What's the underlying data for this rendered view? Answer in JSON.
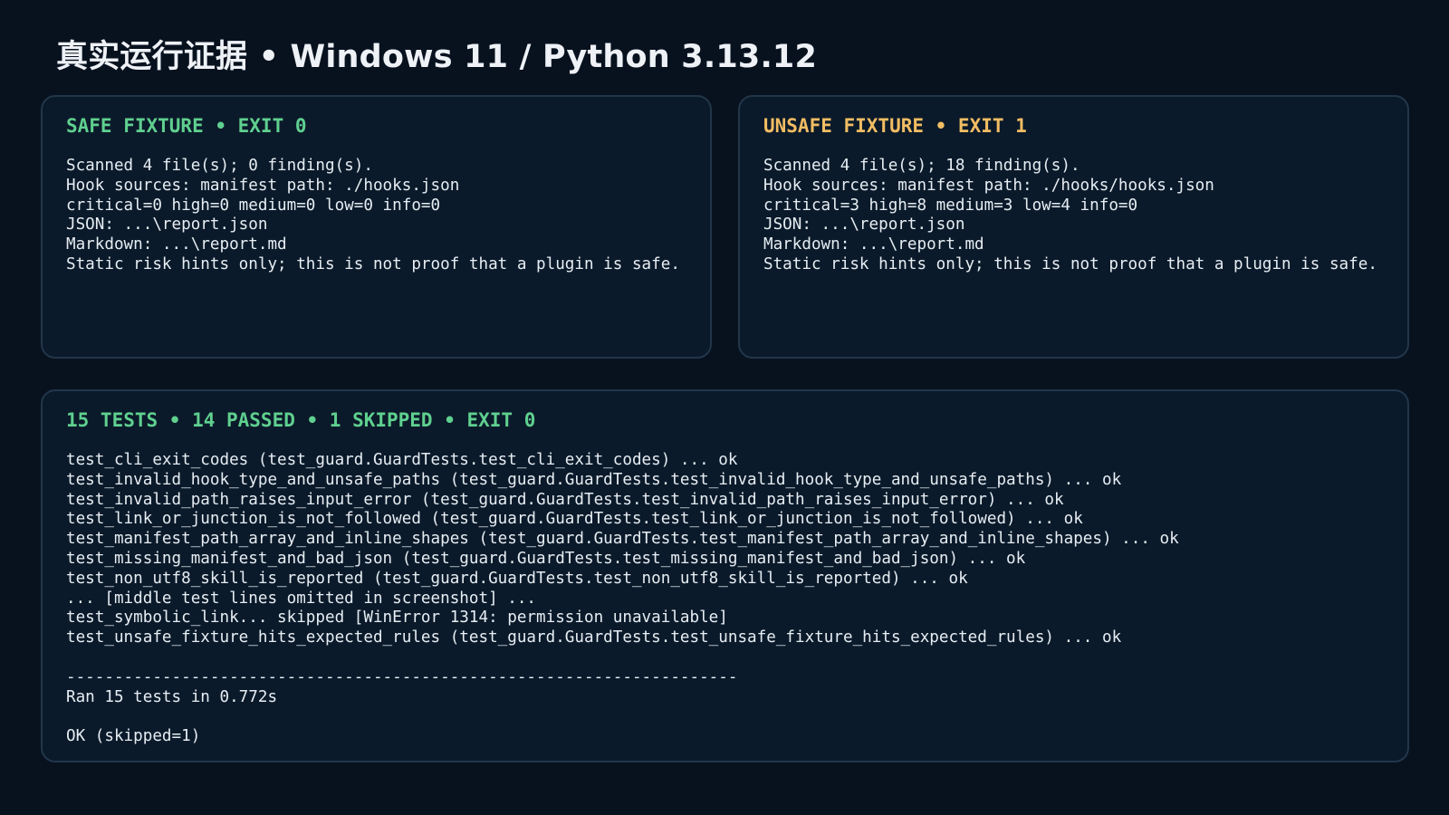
{
  "page": {
    "title": "真实运行证据 • Windows 11 / Python 3.13.12"
  },
  "colors": {
    "background": "#08121f",
    "panel_background": "#0b1a2a",
    "panel_border": "#22364a",
    "text": "#e6edf3",
    "pass_green": "#5fd08f",
    "warn_orange": "#f2bd63"
  },
  "safe_panel": {
    "heading": "SAFE FIXTURE • EXIT 0",
    "accent": "#5fd08f",
    "lines": [
      "Scanned 4 file(s); 0 finding(s).",
      "Hook sources: manifest path: ./hooks.json",
      "critical=0 high=0 medium=0 low=0 info=0",
      "JSON: ...\\report.json",
      "Markdown: ...\\report.md",
      "Static risk hints only; this is not proof that a plugin is safe."
    ]
  },
  "unsafe_panel": {
    "heading": "UNSAFE FIXTURE • EXIT 1",
    "accent": "#f2bd63",
    "lines": [
      "Scanned 4 file(s); 18 finding(s).",
      "Hook sources: manifest path: ./hooks/hooks.json",
      "critical=3 high=8 medium=3 low=4 info=0",
      "JSON: ...\\report.json",
      "Markdown: ...\\report.md",
      "Static risk hints only; this is not proof that a plugin is safe."
    ]
  },
  "tests_panel": {
    "heading": "15 TESTS • 14 PASSED • 1 SKIPPED • EXIT 0",
    "accent": "#5fd08f",
    "lines": [
      "test_cli_exit_codes (test_guard.GuardTests.test_cli_exit_codes) ... ok",
      "test_invalid_hook_type_and_unsafe_paths (test_guard.GuardTests.test_invalid_hook_type_and_unsafe_paths) ... ok",
      "test_invalid_path_raises_input_error (test_guard.GuardTests.test_invalid_path_raises_input_error) ... ok",
      "test_link_or_junction_is_not_followed (test_guard.GuardTests.test_link_or_junction_is_not_followed) ... ok",
      "test_manifest_path_array_and_inline_shapes (test_guard.GuardTests.test_manifest_path_array_and_inline_shapes) ... ok",
      "test_missing_manifest_and_bad_json (test_guard.GuardTests.test_missing_manifest_and_bad_json) ... ok",
      "test_non_utf8_skill_is_reported (test_guard.GuardTests.test_non_utf8_skill_is_reported) ... ok",
      "... [middle test lines omitted in screenshot] ...",
      "test_symbolic_link... skipped [WinError 1314: permission unavailable]",
      "test_unsafe_fixture_hits_expected_rules (test_guard.GuardTests.test_unsafe_fixture_hits_expected_rules) ... ok",
      "",
      "----------------------------------------------------------------------",
      "Ran 15 tests in 0.772s",
      "",
      "OK (skipped=1)"
    ]
  }
}
